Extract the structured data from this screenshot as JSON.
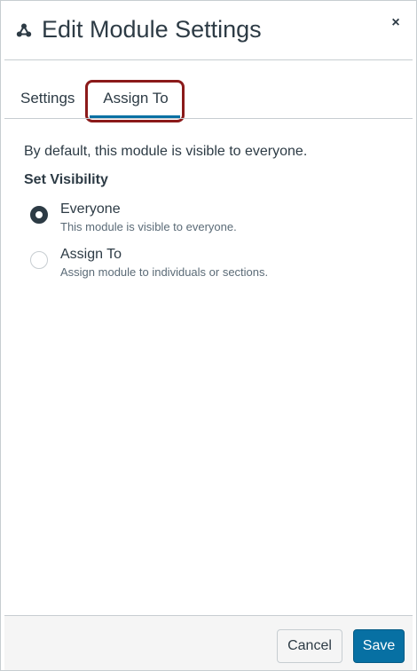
{
  "modal": {
    "title": "Edit Module Settings",
    "header_icon": "module-icon",
    "close_glyph": "×"
  },
  "tabs": [
    {
      "label": "Settings",
      "selected": false
    },
    {
      "label": "Assign To",
      "selected": true
    }
  ],
  "assign_panel": {
    "description": "By default, this module is visible to everyone.",
    "section_title": "Set Visibility",
    "options": [
      {
        "label": "Everyone",
        "sublabel": "This module is visible to everyone.",
        "checked": true
      },
      {
        "label": "Assign To",
        "sublabel": "Assign module to individuals or sections.",
        "checked": false
      }
    ]
  },
  "footer": {
    "cancel_label": "Cancel",
    "save_label": "Save"
  },
  "colors": {
    "accent": "#0770a3",
    "text": "#2d3b45",
    "highlight": "#8b1a1a",
    "border": "#c7cdd1"
  }
}
